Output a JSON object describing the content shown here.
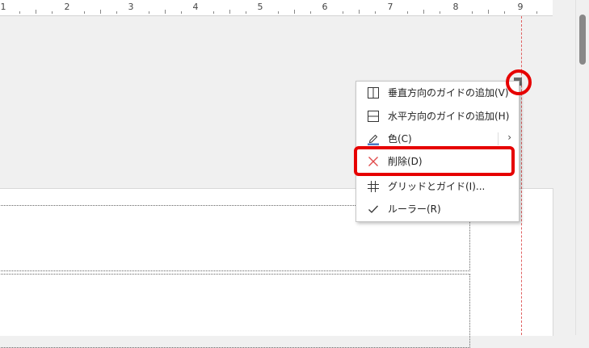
{
  "ruler": {
    "numbers": [
      "1",
      "2",
      "3",
      "4",
      "5",
      "6",
      "7",
      "8",
      "9"
    ]
  },
  "context_menu": {
    "items": [
      {
        "label": "垂直方向のガイドの追加(V)",
        "icon": "vertical-guide-icon"
      },
      {
        "label": "水平方向のガイドの追加(H)",
        "icon": "horizontal-guide-icon"
      },
      {
        "label": "色(C)",
        "icon": "pen-color-icon",
        "submenu_arrow": "›"
      },
      {
        "label": "削除(D)",
        "icon": "delete-x-icon"
      },
      {
        "label": "グリッドとガイド(I)...",
        "icon": "grid-icon"
      },
      {
        "label": "ルーラー(R)",
        "icon": "check-icon"
      }
    ]
  },
  "colors": {
    "highlight": "#e60000",
    "guide_line": "#e06060",
    "delete_icon": "#e04848",
    "pen_color_bar": "#4a78c2"
  }
}
